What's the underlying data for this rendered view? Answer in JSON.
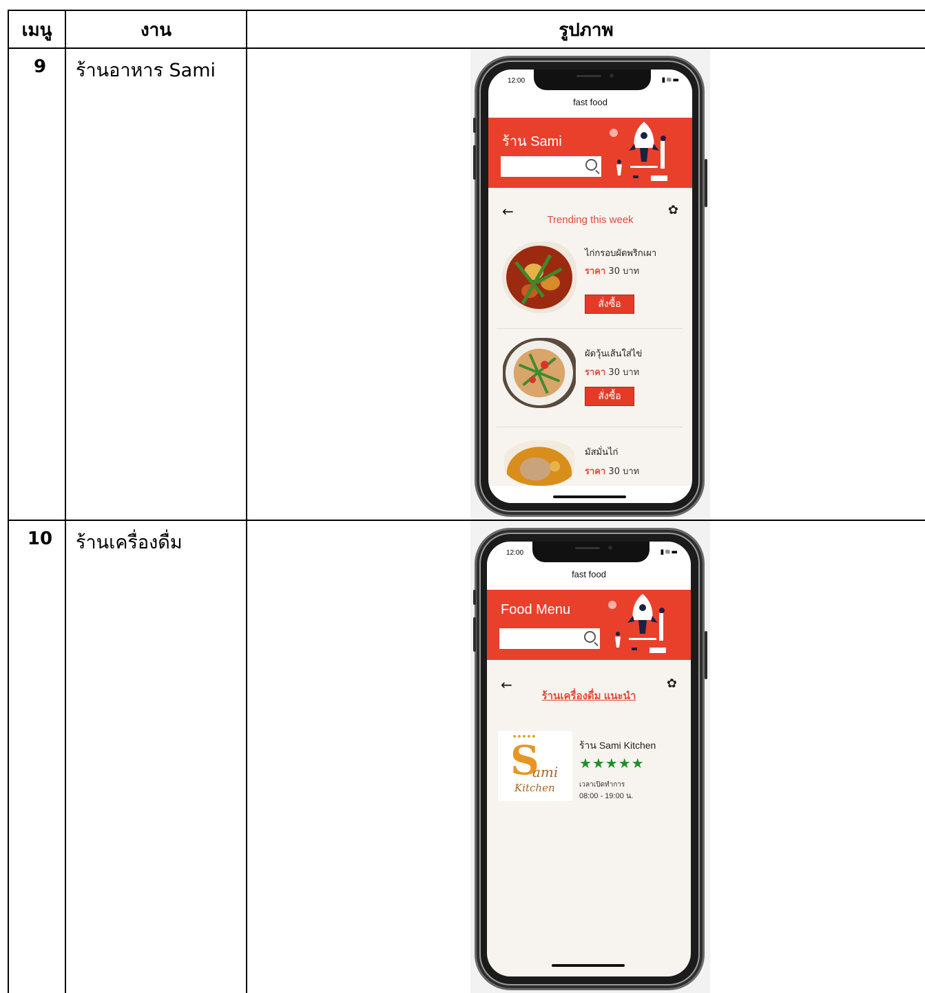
{
  "table": {
    "headers": {
      "menu": "เมนู",
      "task": "งาน",
      "image": "รูปภาพ"
    },
    "rows": [
      {
        "num": "9",
        "task": "ร้านอาหาร Sami"
      },
      {
        "num": "10",
        "task": "ร้านเครื่องดื่ม"
      }
    ]
  },
  "phone1": {
    "time": "12:00",
    "status_icons": "signal-wifi-battery",
    "app_title": "fast food",
    "shop_title": "ร้าน Sami",
    "section_title": "Trending this week",
    "price_label": "ราคา",
    "buy_label": "สั่งซื้อ",
    "items": [
      {
        "name": "ไก่กรอบผัดพริกเผา",
        "price": "30 บาท"
      },
      {
        "name": "ผัดวุ้นเส้นใส่ไข่",
        "price": "30 บาท"
      },
      {
        "name": "มัสมั่นไก่",
        "price": "30 บาท"
      }
    ]
  },
  "phone2": {
    "time": "12:00",
    "app_title": "fast food",
    "shop_title": "Food Menu",
    "section_title": "ร้านเครื่องดื่ม แนะนำ",
    "logo": {
      "big": "S",
      "ami": "ami",
      "kitchen": "Kitchen"
    },
    "shop_name": "ร้าน Sami Kitchen",
    "rating": 4.5,
    "stars": "★★★★★",
    "hours_label": "เวลาเปิดทำการ",
    "hours": "08:00 - 19:00 น."
  },
  "colors": {
    "brand_red": "#e9402c",
    "star_green": "#1f8f2a"
  }
}
